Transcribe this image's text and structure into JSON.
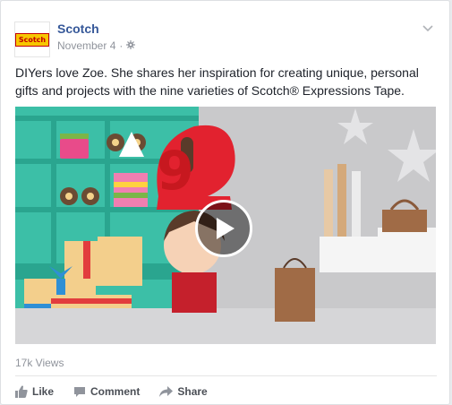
{
  "post": {
    "page_name": "Scotch",
    "logo_text": "Scotch",
    "date": "November 4",
    "separator": "·",
    "privacy_icon": "globe-icon",
    "options_icon": "chevron-down-icon",
    "text": "DIYers love Zoe. She shares her inspiration for creating unique, personal gifts and projects with the nine varieties of Scotch® Expressions Tape.",
    "video": {
      "big_number": "9",
      "play_icon": "play-icon"
    },
    "views": "17k Views"
  },
  "actions": {
    "like_label": "Like",
    "comment_label": "Comment",
    "share_label": "Share"
  }
}
